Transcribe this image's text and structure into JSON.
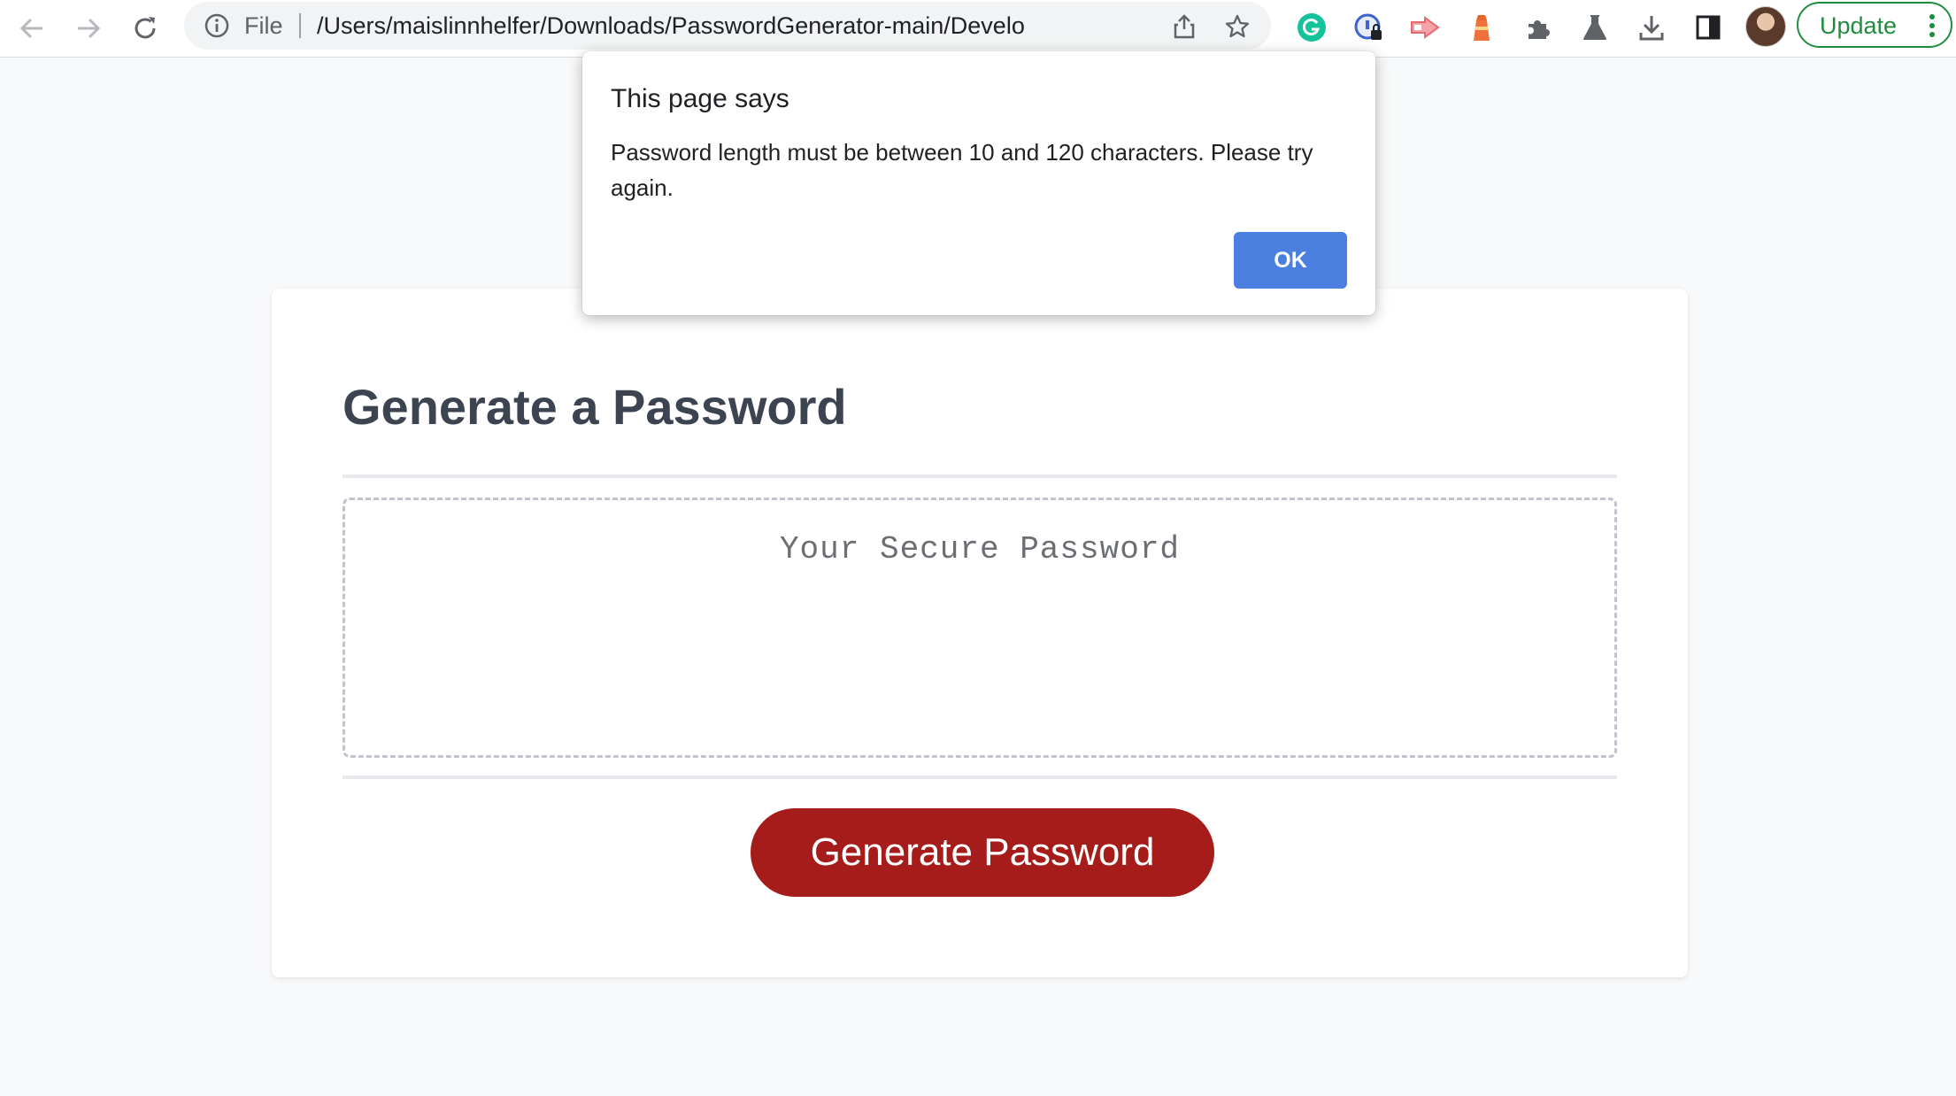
{
  "browser": {
    "address_bar": {
      "scheme_label": "File",
      "url": "/Users/maislinnhelfer/Downloads/PasswordGenerator-main/Develop/i..."
    },
    "update_button_label": "Update",
    "extensions": [
      "grammarly-icon",
      "password-manager-icon",
      "screen-recorder-icon",
      "lighthouse-icon",
      "extensions-puzzle-icon",
      "labs-flask-icon"
    ]
  },
  "page": {
    "title": "Generate a Password",
    "password_placeholder": "Your Secure Password",
    "generate_button_label": "Generate Password",
    "accent_color": "#a51c1a"
  },
  "dialog": {
    "title": "This page says",
    "message": "Password length must be between 10 and 120 characters. Please try again.",
    "ok_label": "OK",
    "ok_color": "#4a7fe0"
  }
}
